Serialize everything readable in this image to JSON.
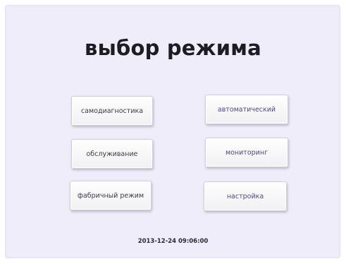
{
  "screen": {
    "title": "выбор режима",
    "datetime": "2013-12-24  09:06:00"
  },
  "buttons": {
    "self_diagnostics": "самодиагностика",
    "service": "обслуживание",
    "factory_mode": "фабричный режим",
    "automatic": "автоматический",
    "monitoring": "мониторинг",
    "settings": "настройка"
  },
  "colors": {
    "background": "#eeedf9",
    "title_text": "#1c1c22",
    "left_button_text": "#3a3a46",
    "right_button_text": "#4a4a78"
  }
}
